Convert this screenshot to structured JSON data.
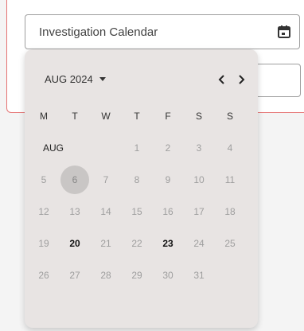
{
  "field": {
    "label": "Investigation Calendar",
    "icon": "calendar-icon"
  },
  "picker": {
    "month_label": "AUG 2024",
    "month_short": "AUG",
    "weekdays": [
      "M",
      "T",
      "W",
      "T",
      "F",
      "S",
      "S"
    ],
    "days": [
      {
        "n": "1"
      },
      {
        "n": "2"
      },
      {
        "n": "3"
      },
      {
        "n": "4"
      },
      {
        "n": "5"
      },
      {
        "n": "6",
        "selected": true
      },
      {
        "n": "7"
      },
      {
        "n": "8"
      },
      {
        "n": "9"
      },
      {
        "n": "10"
      },
      {
        "n": "11"
      },
      {
        "n": "12"
      },
      {
        "n": "13"
      },
      {
        "n": "14"
      },
      {
        "n": "15"
      },
      {
        "n": "16"
      },
      {
        "n": "17"
      },
      {
        "n": "18"
      },
      {
        "n": "19"
      },
      {
        "n": "20",
        "bold": true
      },
      {
        "n": "21"
      },
      {
        "n": "22"
      },
      {
        "n": "23",
        "bold": true
      },
      {
        "n": "24"
      },
      {
        "n": "25"
      },
      {
        "n": "26"
      },
      {
        "n": "27"
      },
      {
        "n": "28"
      },
      {
        "n": "29"
      },
      {
        "n": "30"
      },
      {
        "n": "31"
      }
    ],
    "first_weekday_index": 3
  },
  "colors": {
    "accent_border": "#e57373",
    "popup_bg": "#e8e4e3",
    "selected_bg": "#c9c6c5"
  }
}
